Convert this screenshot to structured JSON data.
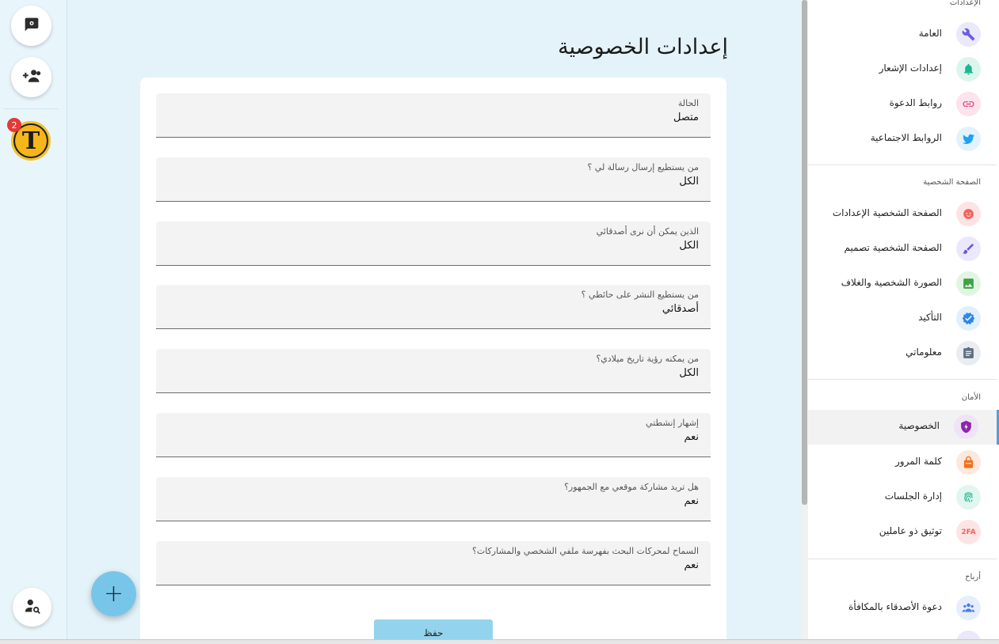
{
  "page": {
    "title": "إعدادات الخصوصية"
  },
  "rail": {
    "avatar_badge": "2",
    "avatar_letter": "T",
    "fab_label": "+"
  },
  "privacy_fields": [
    {
      "label": "الحالة",
      "value": "متصل"
    },
    {
      "label": "من يستطيع إرسال رسالة لي ؟",
      "value": "الكل"
    },
    {
      "label": "الذين يمكن أن نرى أصدقائي",
      "value": "الكل"
    },
    {
      "label": "من يستطيع النشر على حائطي ؟",
      "value": "أصدقائي"
    },
    {
      "label": "من يمكنه رؤية تاريخ ميلادي؟",
      "value": "الكل"
    },
    {
      "label": "إشهار إنشطتي",
      "value": "نعم"
    },
    {
      "label": "هل تريد مشاركة موقعي مع الجمهور؟",
      "value": "نعم"
    },
    {
      "label": "السماح لمحركات البحث بفهرسة ملفي الشخصي والمشاركات؟",
      "value": "نعم"
    }
  ],
  "save_label": "حفظ",
  "sidebar": {
    "sections": [
      {
        "title": "الإعدادات"
      },
      {
        "title": "الصفحة الشخصية"
      },
      {
        "title": "الأمان"
      },
      {
        "title": "أرباح"
      }
    ],
    "items": [
      {
        "label": "العامة",
        "icon": "wrench-icon",
        "bg": "#eae8fb",
        "color": "#6c5ce7"
      },
      {
        "label": "إعدادات الإشعار",
        "icon": "bell-icon",
        "bg": "#ddf5ee",
        "color": "#1fb58f"
      },
      {
        "label": "روابط الدعوة",
        "icon": "link-icon",
        "bg": "#fde3ec",
        "color": "#e84a7f"
      },
      {
        "label": "الروابط الاجتماعية",
        "icon": "twitter-icon",
        "bg": "#e2f2fc",
        "color": "#1da1f2"
      },
      {
        "label": "الصفحة الشخصية الإعدادات",
        "icon": "face-icon",
        "bg": "#fde4e4",
        "color": "#ef6461"
      },
      {
        "label": "الصفحة الشخصية تصميم",
        "icon": "brush-icon",
        "bg": "#ebe8fb",
        "color": "#6a5ae0"
      },
      {
        "label": "الصورة الشخصية والغلاف",
        "icon": "image-icon",
        "bg": "#e1f5e3",
        "color": "#43a047"
      },
      {
        "label": "التأكيد",
        "icon": "verified-icon",
        "bg": "#e2effc",
        "color": "#2f86e8"
      },
      {
        "label": "معلوماتي",
        "icon": "clipboard-icon",
        "bg": "#e9edf1",
        "color": "#5f6f7f"
      },
      {
        "label": "الخصوصية",
        "icon": "shield-icon",
        "bg": "#efe3f8",
        "color": "#8e24aa"
      },
      {
        "label": "كلمة المرور",
        "icon": "lock-icon",
        "bg": "#fde8df",
        "color": "#f2711c"
      },
      {
        "label": "إدارة الجلسات",
        "icon": "fingerprint-icon",
        "bg": "#e0f6ee",
        "color": "#1fb58f"
      },
      {
        "label": "توثيق ذو عاملين",
        "icon": "2fa-icon",
        "bg": "#fde4e4",
        "color": "#ef6461"
      },
      {
        "label": "دعوة الأصدقاء بالمكافأة",
        "icon": "group-icon",
        "bg": "#e6eefc",
        "color": "#4a7ce8"
      }
    ]
  }
}
